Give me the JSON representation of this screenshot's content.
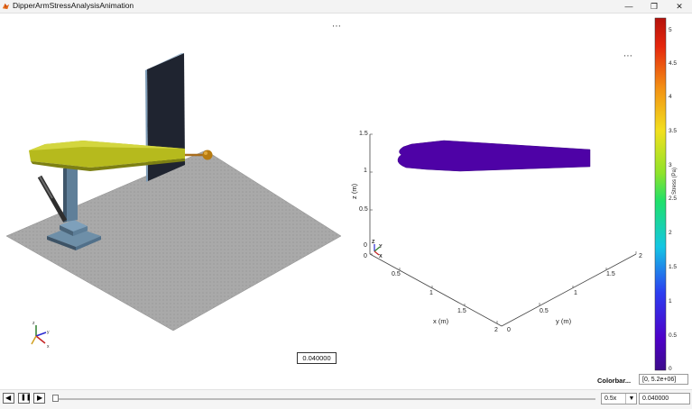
{
  "window": {
    "title": "DipperArmStressAnalysisAnimation",
    "minimize_glyph": "—",
    "restore_glyph": "❐",
    "close_glyph": "✕"
  },
  "icons": {
    "app": "matlab-icon",
    "more_options": "more-options-icon",
    "triad": "axes-triad-icon"
  },
  "left_view": {
    "more_glyph": "⋯",
    "time_display": "0.040000",
    "triad_labels": {
      "z": "z",
      "y": "y",
      "x": "x"
    }
  },
  "right_plot": {
    "more_glyph": "⋯",
    "z_axis_label": "z (m)",
    "x_axis_label": "x (m)",
    "y_axis_label": "y (m)",
    "z_ticks": [
      "0",
      "0.5",
      "1",
      "1.5"
    ],
    "x_ticks": [
      "0",
      "0.5",
      "1",
      "1.5",
      "2"
    ],
    "y_ticks": [
      "0",
      "0.5",
      "1",
      "1.5",
      "2"
    ],
    "triad_labels": {
      "z": "Z",
      "y": "Y",
      "x": "X"
    },
    "body_color": "#4e02a6"
  },
  "colorbar": {
    "label": "Stress (Pa)",
    "ticks": [
      "0",
      "0.5",
      "1",
      "1.5",
      "2",
      "2.5",
      "3",
      "3.5",
      "4",
      "4.5",
      "5"
    ],
    "limits_label": "Colorbar...",
    "limits_value": "[0, 5.2e+06]"
  },
  "playback": {
    "back_label": "◀",
    "pause_label": "❚❚",
    "forward_label": "▶",
    "speed": "0.5x",
    "speed_arrow": "▼",
    "time": "0.040000",
    "progress": 0.0
  }
}
